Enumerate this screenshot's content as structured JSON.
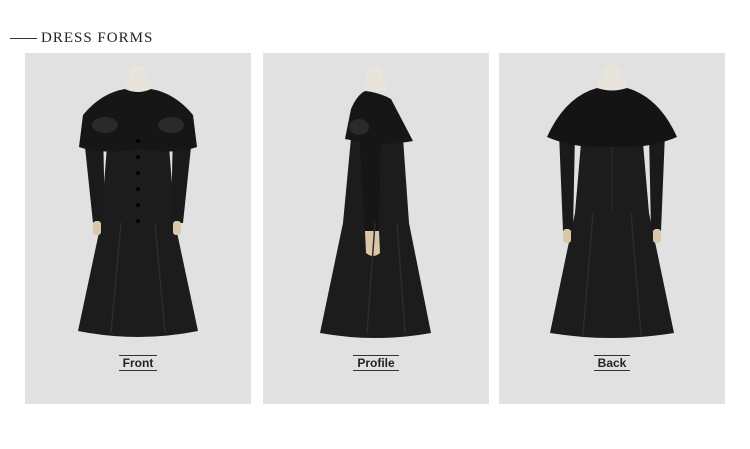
{
  "header": {
    "title": "DRESS FORMS"
  },
  "views": [
    {
      "label": "Front"
    },
    {
      "label": "Profile"
    },
    {
      "label": "Back"
    }
  ],
  "colors": {
    "background": "#e1e1e1",
    "garment": "#1a1a1a",
    "mannequin": "#e9e4db"
  }
}
